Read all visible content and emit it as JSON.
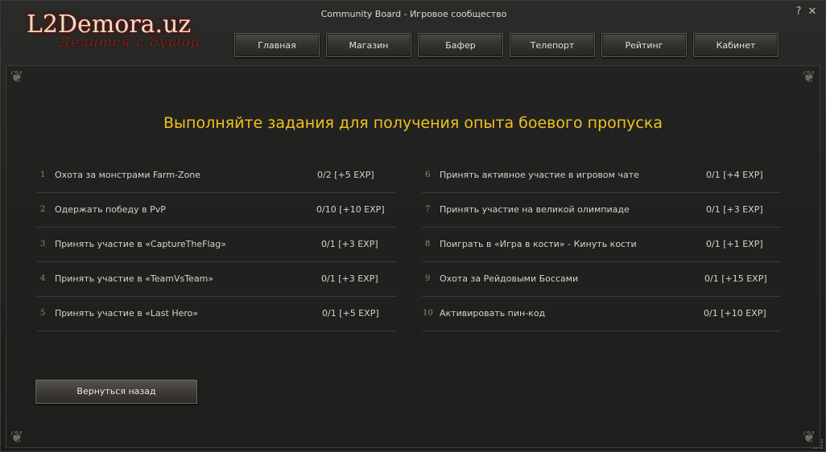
{
  "window": {
    "title": "Community Board - Игровое сообщество",
    "help_label": "?",
    "close_label": "✕"
  },
  "logo": {
    "main": "L2Demora.uz",
    "sub": "Делится с душой"
  },
  "nav": {
    "items": [
      {
        "label": "Главная"
      },
      {
        "label": "Магазин"
      },
      {
        "label": "Бафер"
      },
      {
        "label": "Телепорт"
      },
      {
        "label": "Рейтинг"
      },
      {
        "label": "Кабинет"
      }
    ]
  },
  "main": {
    "heading": "Выполняйте задания для получения опыта боевого пропуска",
    "left_tasks": [
      {
        "num": "1",
        "name": "Охота за монстрами Farm-Zone",
        "progress": "0/2  [+5 EXP]"
      },
      {
        "num": "2",
        "name": "Одержать победу в PvP",
        "progress": "0/10 [+10 EXP]"
      },
      {
        "num": "3",
        "name": "Принять участие в «CaptureTheFlag»",
        "progress": "0/1 [+3 EXP]"
      },
      {
        "num": "4",
        "name": "Принять участие в «TeamVsTeam»",
        "progress": "0/1 [+3 EXP]"
      },
      {
        "num": "5",
        "name": "Принять участие в «Last Hero»",
        "progress": "0/1 [+5 EXP]"
      }
    ],
    "right_tasks": [
      {
        "num": "6",
        "name": "Принять активное участие в игровом чате",
        "progress": "0/1 [+4 EXP]"
      },
      {
        "num": "7",
        "name": "Принять участие на великой олимпиаде",
        "progress": "0/1 [+3 EXP]"
      },
      {
        "num": "8",
        "name": "Поиграть в «Игра в кости» - Кинуть кости",
        "progress": "0/1 [+1 EXP]"
      },
      {
        "num": "9",
        "name": "Охота за Рейдовыми Боссами",
        "progress": "0/1 [+15 EXP]"
      },
      {
        "num": "10",
        "name": "Активировать пин-код",
        "progress": "0/1 [+10 EXP]"
      }
    ],
    "back_label": "Вернуться назад"
  },
  "colors": {
    "heading": "#f1c21c",
    "background": "#1e1e1d",
    "text": "#d4d4cc"
  }
}
